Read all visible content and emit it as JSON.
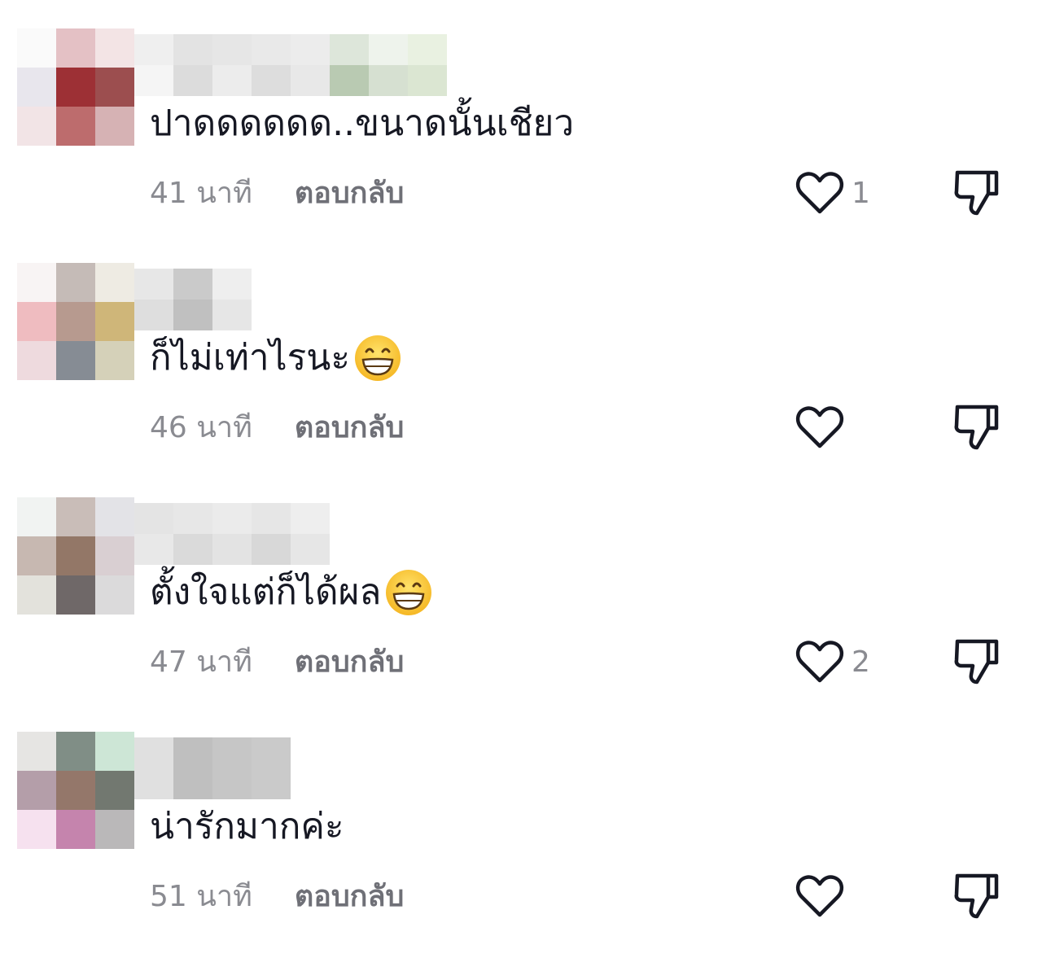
{
  "comments": [
    {
      "text": "ปาดดดดดด..ขนาดนั้นเชียว",
      "time": "41 นาที",
      "reply_label": "ตอบกลับ",
      "like_count": "1",
      "has_emoji": false,
      "avatar_colors": [
        "#fafafa",
        "#e4c1c5",
        "#f3e4e5",
        "#e8e6ed",
        "#9d3035",
        "#9c4e4f",
        "#f2e4e6",
        "#bd6c6d",
        "#d6b2b4"
      ],
      "username_colors": [
        [
          "#efefef",
          "#f5f5f5"
        ],
        [
          "#e3e3e3",
          "#dcdcdc"
        ],
        [
          "#e6e6e6",
          "#ececec"
        ],
        [
          "#e9e9e9",
          "#dddddd"
        ],
        [
          "#ececec",
          "#e8e8e8"
        ],
        [
          "#dde6da",
          "#b9cab2"
        ],
        [
          "#eef3ec",
          "#d6e0d1"
        ],
        [
          "#e9f1e1",
          "#dbe6d2"
        ]
      ]
    },
    {
      "text": "ก็ไม่เท่าไรนะ",
      "time": "46 นาที",
      "reply_label": "ตอบกลับ",
      "like_count": "",
      "has_emoji": true,
      "avatar_colors": [
        "#f8f4f4",
        "#c5bbb7",
        "#eeebe3",
        "#efbcc0",
        "#b79a8f",
        "#cfb679",
        "#eedade",
        "#868c94",
        "#d5d1b9"
      ],
      "username_colors": [
        [
          "#e7e7e7",
          "#dedede"
        ],
        [
          "#cacaca",
          "#c0c0c0"
        ],
        [
          "#eeeeee",
          "#e6e6e6"
        ]
      ]
    },
    {
      "text": "ตั้งใจแต่ก็ได้ผล",
      "time": "47 นาที",
      "reply_label": "ตอบกลับ",
      "like_count": "2",
      "has_emoji": true,
      "avatar_colors": [
        "#f1f3f2",
        "#c9bdb8",
        "#e3e3e7",
        "#c7b8b1",
        "#937767",
        "#d9cfd2",
        "#e3e2dc",
        "#6f6868",
        "#dbdadb"
      ],
      "username_colors": [
        [
          "#e4e4e4",
          "#e8e8e8"
        ],
        [
          "#e7e7e7",
          "#dadada"
        ],
        [
          "#ebebeb",
          "#e3e3e3"
        ],
        [
          "#e6e6e6",
          "#d8d8d8"
        ],
        [
          "#eeeeee",
          "#e6e6e6"
        ]
      ]
    },
    {
      "text": "น่ารักมากค่ะ",
      "time": "51 นาที",
      "reply_label": "ตอบกลับ",
      "like_count": "",
      "has_emoji": false,
      "avatar_colors": [
        "#e6e5e3",
        "#808e86",
        "#cde6d6",
        "#b49ea9",
        "#94776a",
        "#727870",
        "#f6e1ef",
        "#c584ad",
        "#bab8b9"
      ],
      "username_colors": [
        [
          "#e0e0e0",
          "#e0e0e0"
        ],
        [
          "#bfbfbf",
          "#bfbfbf"
        ],
        [
          "#c6c6c6",
          "#c6c6c6"
        ],
        [
          "#cacaca",
          "#cacaca"
        ]
      ]
    }
  ],
  "icons": {
    "like": "heart-outline-icon",
    "dislike": "thumbs-down-icon",
    "emoji": "grinning-face-emoji"
  },
  "colors": {
    "text": "#161823",
    "meta": "#8a8b91",
    "icon": "#161823"
  }
}
